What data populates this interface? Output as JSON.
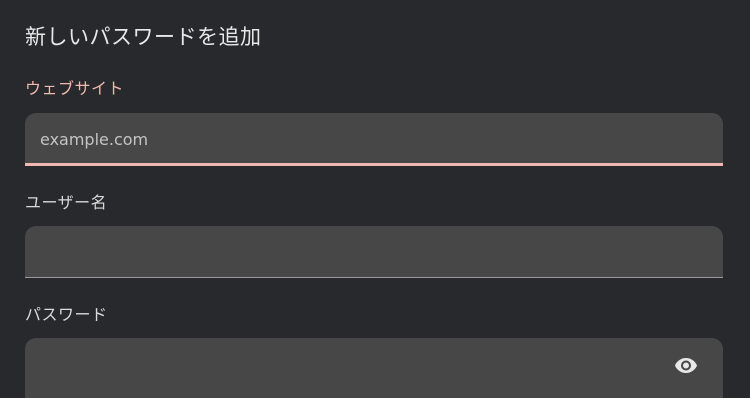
{
  "dialog": {
    "title": "新しいパスワードを追加"
  },
  "fields": {
    "website": {
      "label": "ウェブサイト",
      "placeholder": "example.com",
      "value": "",
      "focused": true
    },
    "username": {
      "label": "ユーザー名",
      "placeholder": "",
      "value": ""
    },
    "password": {
      "label": "パスワード",
      "placeholder": "",
      "value": "",
      "toggle_icon": "eye-icon"
    }
  },
  "colors": {
    "background": "#28292c",
    "field_background": "#464746",
    "accent": "#f0b8ae",
    "text": "#e3e3e3"
  }
}
